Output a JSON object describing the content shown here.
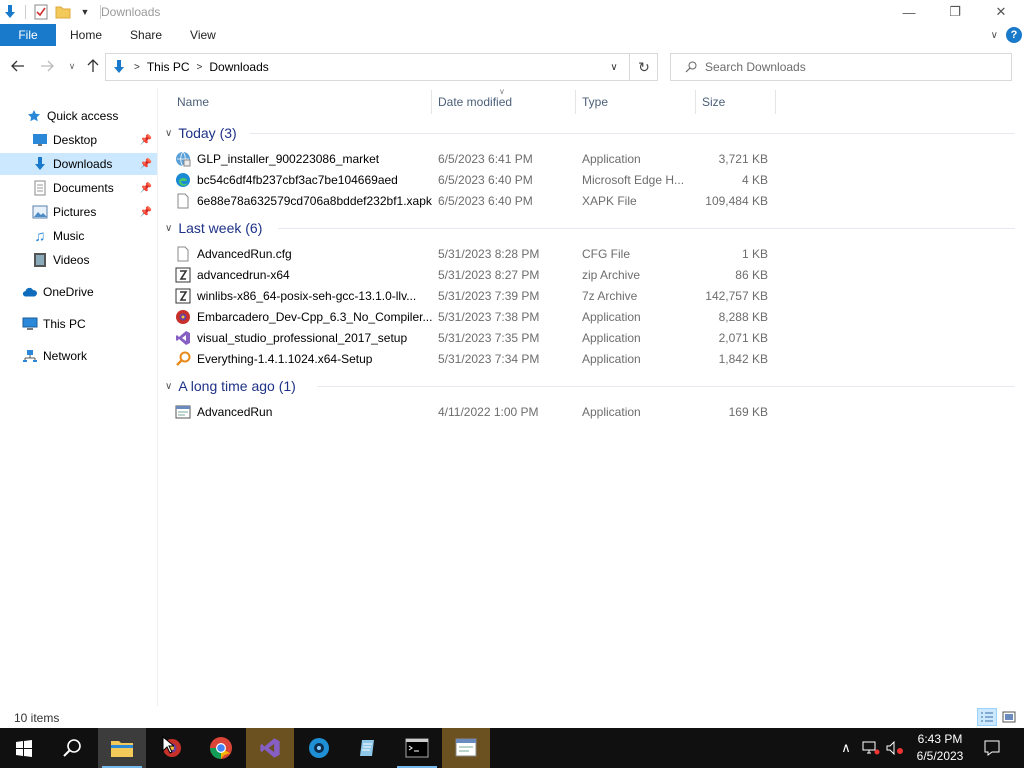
{
  "window": {
    "title": "Downloads",
    "minimize": "—",
    "maximize": "❐",
    "close": "✕"
  },
  "ribbon": {
    "tabs": [
      "File",
      "Home",
      "Share",
      "View"
    ],
    "help": "?"
  },
  "address": {
    "crumbs": [
      "This PC",
      "Downloads"
    ],
    "refresh": "↻"
  },
  "search": {
    "placeholder": "Search Downloads"
  },
  "navpane": {
    "quick_access": "Quick access",
    "desktop": "Desktop",
    "downloads": "Downloads",
    "documents": "Documents",
    "pictures": "Pictures",
    "music": "Music",
    "videos": "Videos",
    "onedrive": "OneDrive",
    "thispc": "This PC",
    "network": "Network"
  },
  "columns": {
    "name": "Name",
    "date": "Date modified",
    "type": "Type",
    "size": "Size"
  },
  "groups": [
    {
      "label": "Today (3)",
      "rows": [
        {
          "name": "GLP_installer_900223086_market",
          "date": "6/5/2023 6:41 PM",
          "type": "Application",
          "size": "3,721 KB",
          "icon": "installer-globe-icon"
        },
        {
          "name": "bc54c6df4fb237cbf3ac7be104669aed",
          "date": "6/5/2023 6:40 PM",
          "type": "Microsoft Edge H...",
          "size": "4 KB",
          "icon": "edge-icon"
        },
        {
          "name": "6e88e78a632579cd706a8bddef232bf1.xapk",
          "date": "6/5/2023 6:40 PM",
          "type": "XAPK File",
          "size": "109,484 KB",
          "icon": "blank-file-icon"
        }
      ]
    },
    {
      "label": "Last week (6)",
      "rows": [
        {
          "name": "AdvancedRun.cfg",
          "date": "5/31/2023 8:28 PM",
          "type": "CFG File",
          "size": "1 KB",
          "icon": "blank-file-icon"
        },
        {
          "name": "advancedrun-x64",
          "date": "5/31/2023 8:27 PM",
          "type": "zip Archive",
          "size": "86 KB",
          "icon": "archive-icon"
        },
        {
          "name": "winlibs-x86_64-posix-seh-gcc-13.1.0-llv...",
          "date": "5/31/2023 7:39 PM",
          "type": "7z Archive",
          "size": "142,757 KB",
          "icon": "archive-icon"
        },
        {
          "name": "Embarcadero_Dev-Cpp_6.3_No_Compiler...",
          "date": "5/31/2023 7:38 PM",
          "type": "Application",
          "size": "8,288 KB",
          "icon": "devcpp-icon"
        },
        {
          "name": "visual_studio_professional_2017_setup",
          "date": "5/31/2023 7:35 PM",
          "type": "Application",
          "size": "2,071 KB",
          "icon": "visual-studio-icon"
        },
        {
          "name": "Everything-1.4.1.1024.x64-Setup",
          "date": "5/31/2023 7:34 PM",
          "type": "Application",
          "size": "1,842 KB",
          "icon": "everything-search-icon"
        }
      ]
    },
    {
      "label": "A long time ago (1)",
      "rows": [
        {
          "name": "AdvancedRun",
          "date": "4/11/2022 1:00 PM",
          "type": "Application",
          "size": "169 KB",
          "icon": "app-window-icon"
        }
      ]
    }
  ],
  "status": {
    "items": "10 items"
  },
  "clock": {
    "time": "6:43 PM",
    "date": "6/5/2023"
  },
  "colors": {
    "accent": "#1979ca",
    "selected": "#cce8ff",
    "group_text": "#1e3287",
    "taskbar": "#101010"
  }
}
